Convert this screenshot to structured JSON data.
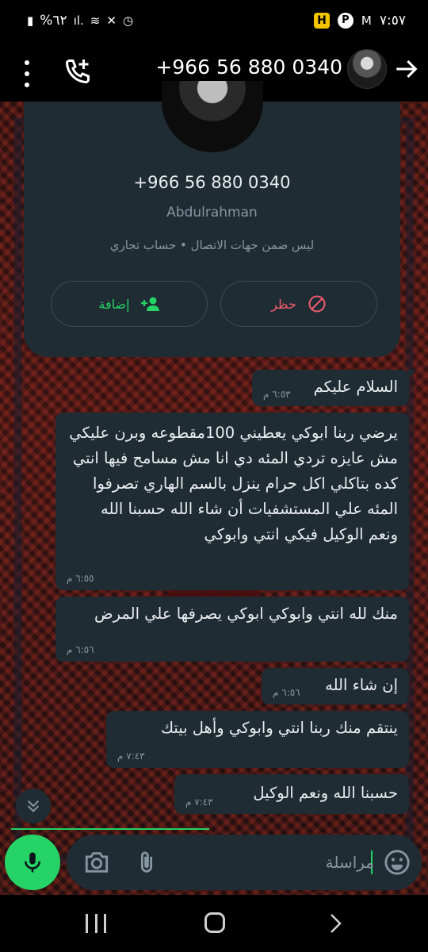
{
  "status_bar": {
    "time": "٧:٥٧",
    "battery": "%٦٢",
    "notification_letter": "H"
  },
  "header": {
    "phone_number": "+966 56 880 0340"
  },
  "contact_card": {
    "phone_number": "+966 56 880 0340",
    "name": "Abdulrahman",
    "info": "ليس ضمن جهات الاتصال • حساب تجاري",
    "add_label": "إضافة",
    "block_label": "حظر"
  },
  "messages": [
    {
      "text": "السلام عليكم",
      "time": "٦:٥٣ م"
    },
    {
      "text": "يرضي ربنا ابوكي يعطيني 100مقطوعه وبرن عليكي مش عايزه تردي المئه دي انا مش مسامح فيها انتي كده بتاكلي اكل حرام ينزل بالسم الهاري تصرفوا المئه علي المستشفيات أن شاء الله حسبنا الله ونعم الوكيل فيكي انتي وابوكي",
      "time": "٦:٥٥ م"
    },
    {
      "text": "منك لله انتي وابوكي ابوكي يصرفها علي المرض",
      "time": "٦:٥٦ م"
    },
    {
      "text": "إن شاء الله",
      "time": "٦:٥٦ م"
    },
    {
      "text": "ينتقم منك ربنا انتي وابوكي وأهل بيتك",
      "time": "٧:٤٣ م"
    },
    {
      "text": "حسبنا الله ونعم الوكيل",
      "time": "٧:٤٣ م"
    }
  ],
  "input": {
    "placeholder": "مراسلة"
  },
  "colors": {
    "accent": "#25d366",
    "danger": "#f15c6d",
    "bubble": "#1f2c33"
  }
}
